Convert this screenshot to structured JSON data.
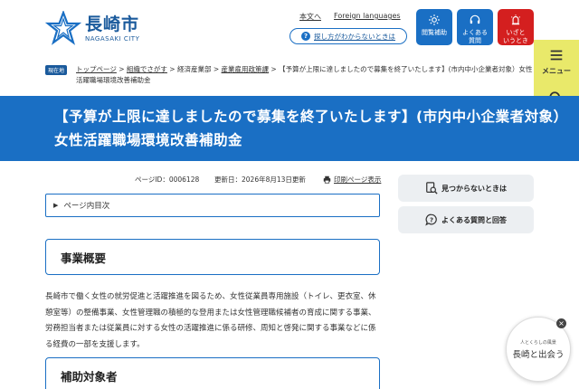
{
  "header": {
    "logo_jp": "長崎市",
    "logo_en": "NAGASAKI CITY",
    "links": [
      "本文へ",
      "Foreign languages"
    ],
    "help_text": "探し方がわからないときは",
    "buttons": [
      {
        "label": "閲覧補助",
        "icon": "gear-icon"
      },
      {
        "label": "よくある\n質問",
        "icon": "headset-icon"
      },
      {
        "label": "いざと\nいうとき",
        "icon": "alarm-icon"
      }
    ],
    "side_menu": "メニュー",
    "side_search": "検索",
    "colors": {
      "primary": "#1a6fc4",
      "emergency": "#d41f1f",
      "side": "#e9e96a"
    }
  },
  "breadcrumb": {
    "badge": "現在地",
    "items": [
      "トップページ",
      "組織でさがす",
      "経済産業部",
      "産業雇用政策課"
    ],
    "current": "【予算が上限に達しましたので募集を終了いたします】(市内中小企業者対象）女性活躍職場環境改善補助金"
  },
  "page": {
    "title": "【予算が上限に達しましたので募集を終了いたします】(市内中小企業者対象）女性活躍職場環境改善補助金",
    "page_id": "ページID：0006128",
    "updated": "更新日：2026年8月13日更新",
    "print": "印刷ページ表示",
    "toc": "ページ内目次"
  },
  "sections": [
    {
      "heading": "事業概要",
      "body": "長崎市で働く女性の就労促進と活躍推進を図るため、女性従業員専用施設（トイレ、更衣室、休憩室等）の整備事業、女性管理職の積極的な登用または女性管理職候補者の育成に関する事業、労務担当者または従業員に対する女性の活躍推進に係る研修、周知と啓発に関する事業などに係る経費の一部を支援します。"
    },
    {
      "heading": "補助対象者"
    }
  ],
  "sidebar": {
    "buttons": [
      {
        "label": "見つからないときは",
        "icon": "search-doc-icon"
      },
      {
        "label": "よくある質問と回答",
        "icon": "question-bubble-icon"
      }
    ]
  },
  "banner": {
    "sub": "人とくらしの風景",
    "main": "長崎と出会う",
    "close": "×"
  }
}
